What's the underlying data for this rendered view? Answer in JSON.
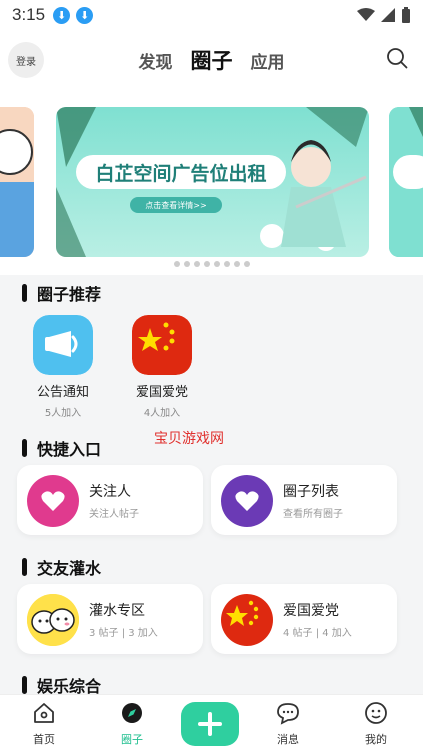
{
  "status": {
    "time": "3:15"
  },
  "header": {
    "login": "登录",
    "tabs": [
      {
        "label": "发现"
      },
      {
        "label": "圈子"
      },
      {
        "label": "应用"
      }
    ],
    "active_tab": "圈子"
  },
  "banner": {
    "title": "白芷空间广告位出租",
    "button": "点击查看详情>>",
    "page_count": 8
  },
  "recommend": {
    "title": "圈子推荐",
    "items": [
      {
        "name": "公告通知",
        "sub": "5人加入",
        "icon": "megaphone-icon"
      },
      {
        "name": "爱国爱党",
        "sub": "4人加入",
        "icon": "china-flag-icon"
      }
    ]
  },
  "quick": {
    "title": "快捷入口",
    "items": [
      {
        "title": "关注人",
        "sub": "关注人帖子",
        "icon": "heart-icon",
        "color": "#e03a8e"
      },
      {
        "title": "圈子列表",
        "sub": "查看所有圈子",
        "icon": "heart-icon",
        "color": "#6b3ab5"
      }
    ]
  },
  "watermark": "宝贝游戏网",
  "social": {
    "title": "交友灌水",
    "items": [
      {
        "title": "灌水专区",
        "sub": "3 帖子 | 3 加入",
        "icon": "cartoon-faces-icon"
      },
      {
        "title": "爱国爱党",
        "sub": "4 帖子 | 4 加入",
        "icon": "china-flag-icon"
      }
    ]
  },
  "entertainment": {
    "title": "娱乐综合"
  },
  "nav": {
    "items": [
      {
        "label": "首页",
        "icon": "home-icon"
      },
      {
        "label": "圈子",
        "icon": "compass-icon"
      },
      {
        "label": "消息",
        "icon": "chat-icon"
      },
      {
        "label": "我的",
        "icon": "profile-icon"
      }
    ],
    "active": "圈子",
    "accent": "#2fcf9f"
  }
}
